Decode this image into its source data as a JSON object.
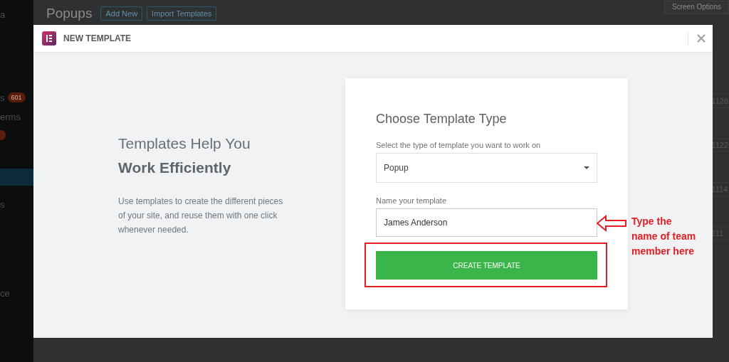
{
  "admin": {
    "page_title": "Popups",
    "buttons": [
      "Add New",
      "Import Templates"
    ],
    "screen_options": "Screen Options",
    "sidebar": [
      {
        "kind": "text",
        "label": "a",
        "selected": false
      },
      {
        "kind": "text",
        "label": "s",
        "badge": "601",
        "selected": false
      },
      {
        "kind": "text",
        "label": "erms",
        "selected": false
      },
      {
        "kind": "badge",
        "selected": false
      },
      {
        "kind": "blank",
        "selected": true
      },
      {
        "kind": "text",
        "label": "s",
        "selected": false
      },
      {
        "kind": "text",
        "label": "ce",
        "selected": false
      }
    ],
    "table_cells": [
      "1126",
      "1122",
      "1114",
      "111"
    ]
  },
  "modal": {
    "title": "NEW TEMPLATE",
    "intro": {
      "heading": "Templates Help You",
      "heading_bold": "Work Efficiently",
      "description": "Use templates to create the different pieces of your site, and reuse them with one click whenever needed."
    },
    "form": {
      "title": "Choose Template Type",
      "type_label": "Select the type of template you want to work on",
      "type_value": "Popup",
      "name_label": "Name your template",
      "name_value": "James Anderson",
      "submit": "CREATE TEMPLATE"
    }
  },
  "annotation": {
    "lines": [
      "Type the",
      "name of team",
      "member here"
    ]
  }
}
